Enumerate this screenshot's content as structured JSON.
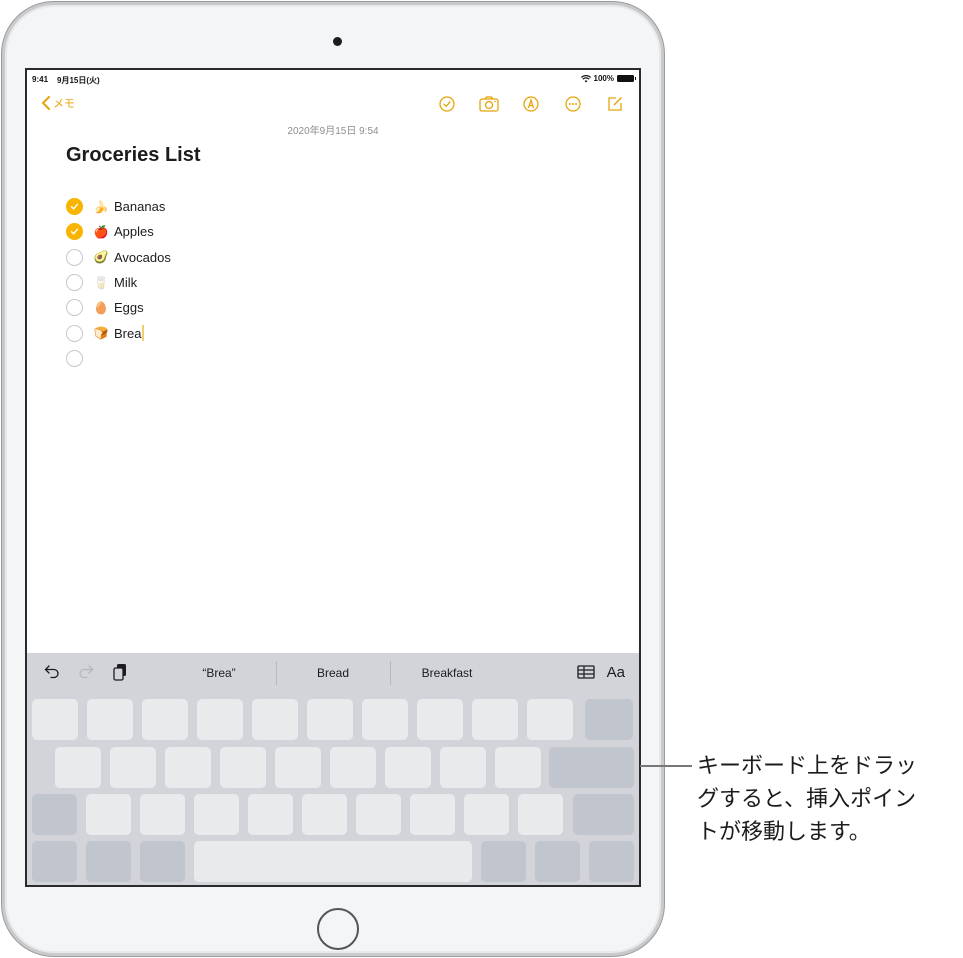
{
  "status_bar": {
    "time": "9:41",
    "date": "9月15日(火)",
    "battery": "100%",
    "wifi_icon": "wifi-icon",
    "battery_icon": "battery-icon"
  },
  "nav": {
    "back_label": "メモ",
    "back_icon": "chevron-left-icon",
    "icons": [
      "checklist-icon",
      "camera-icon",
      "markup-icon",
      "more-icon",
      "compose-icon"
    ]
  },
  "note": {
    "date": "2020年9月15日 9:54",
    "title": "Groceries List",
    "items": [
      {
        "emoji": "🍌",
        "text": "Bananas",
        "checked": true
      },
      {
        "emoji": "🍎",
        "text": "Apples",
        "checked": true
      },
      {
        "emoji": "🥑",
        "text": "Avocados",
        "checked": false
      },
      {
        "emoji": "🥛",
        "text": "Milk",
        "checked": false
      },
      {
        "emoji": "🥚",
        "text": "Eggs",
        "checked": false
      },
      {
        "emoji": "🍞",
        "text": "Brea",
        "checked": false
      },
      {
        "emoji": "",
        "text": "",
        "checked": false
      }
    ]
  },
  "keyboard": {
    "suggestions": [
      "“Brea”",
      "Bread",
      "Breakfast"
    ],
    "format_label": "Aa",
    "left_icons": [
      "undo-icon",
      "redo-icon",
      "paste-icon"
    ],
    "right_icons": [
      "table-icon"
    ]
  },
  "callout": {
    "text": "キーボード上をドラッグすると、挿入ポイントが移動します。",
    "lines": [
      "キーボード上をドラッ",
      "グすると、挿入ポイン",
      "トが移動します。"
    ]
  },
  "colors": {
    "accent": "#e5a50a",
    "checked": "#f8b400",
    "keyboard_bg": "#d3d4d9",
    "key_light": "#e9eaec",
    "key_dark": "#c1c5cd"
  }
}
